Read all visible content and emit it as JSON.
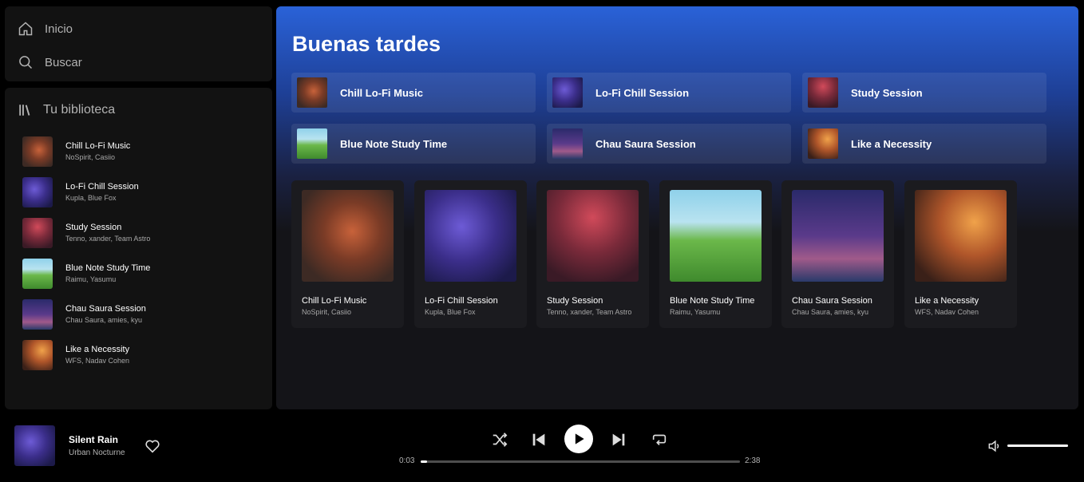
{
  "nav": {
    "home": "Inicio",
    "search": "Buscar"
  },
  "library": {
    "title": "Tu biblioteca",
    "items": [
      {
        "title": "Chill Lo-Fi Music",
        "artists": "NoSpirit, Casiio"
      },
      {
        "title": "Lo-Fi Chill Session",
        "artists": "Kupla, Blue Fox"
      },
      {
        "title": "Study Session",
        "artists": "Tenno, xander, Team Astro"
      },
      {
        "title": "Blue Note Study Time",
        "artists": "Raimu, Yasumu"
      },
      {
        "title": "Chau Saura Session",
        "artists": "Chau Saura, amies, kyu"
      },
      {
        "title": "Like a Necessity",
        "artists": "WFS, Nadav Cohen"
      }
    ]
  },
  "main": {
    "greeting": "Buenas tardes",
    "quick": [
      "Chill Lo-Fi Music",
      "Lo-Fi Chill Session",
      "Study Session",
      "Blue Note Study Time",
      "Chau Saura Session",
      "Like a Necessity"
    ],
    "cards": [
      {
        "title": "Chill Lo-Fi Music",
        "artists": "NoSpirit, Casiio"
      },
      {
        "title": "Lo-Fi Chill Session",
        "artists": "Kupla, Blue Fox"
      },
      {
        "title": "Study Session",
        "artists": "Tenno, xander, Team Astro"
      },
      {
        "title": "Blue Note Study Time",
        "artists": "Raimu, Yasumu"
      },
      {
        "title": "Chau Saura Session",
        "artists": "Chau Saura, amies, kyu"
      },
      {
        "title": "Like a Necessity",
        "artists": "WFS, Nadav Cohen"
      }
    ]
  },
  "player": {
    "title": "Silent Rain",
    "artist": "Urban Nocturne",
    "elapsed": "0:03",
    "duration": "2:38",
    "progress": 0.02,
    "volume": 1.0
  }
}
